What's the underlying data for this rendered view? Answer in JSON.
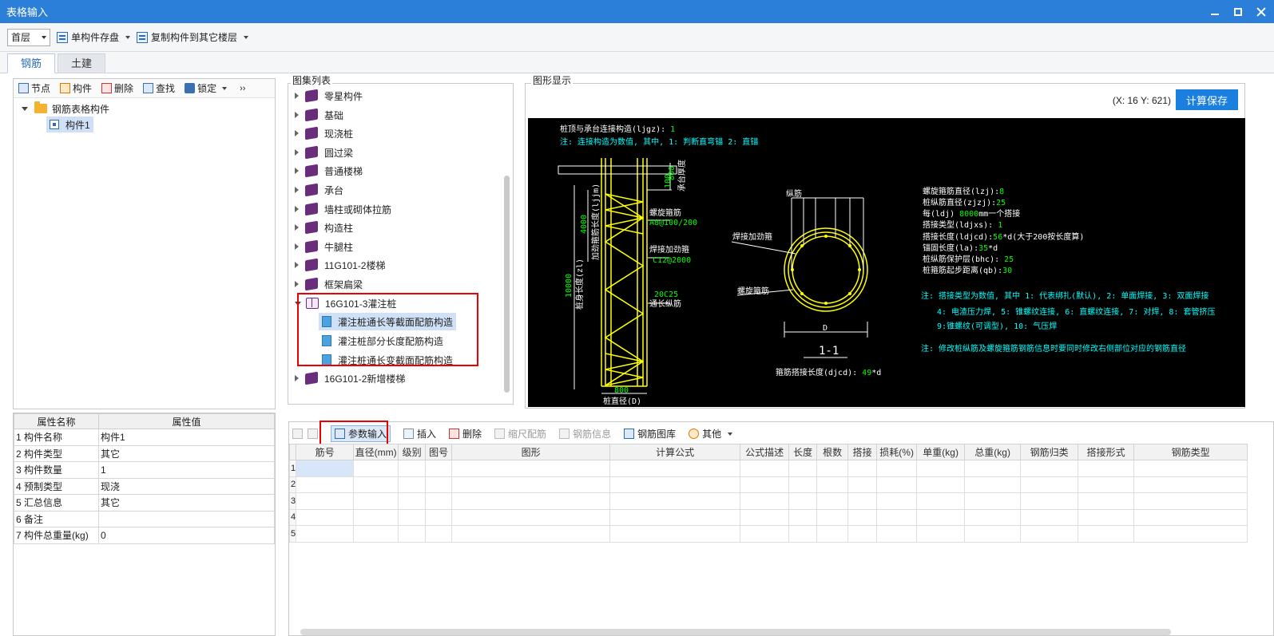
{
  "window": {
    "title": "表格输入"
  },
  "toolbar": {
    "floor_value": "首层",
    "save_component_label": "单构件存盘",
    "copy_to_floors_label": "复制构件到其它楼层"
  },
  "tabs": [
    {
      "label": "钢筋"
    },
    {
      "label": "土建"
    }
  ],
  "left_toolbar": {
    "node_label": "节点",
    "component_label": "构件",
    "delete_label": "删除",
    "find_label": "查找",
    "lock_label": "锁定"
  },
  "tree": {
    "root_label": "钢筋表格构件",
    "child_label": "构件1"
  },
  "properties": {
    "header_name": "属性名称",
    "header_value": "属性值",
    "rows": [
      {
        "num": "1",
        "name": "构件名称",
        "value": "构件1"
      },
      {
        "num": "2",
        "name": "构件类型",
        "value": "其它"
      },
      {
        "num": "3",
        "name": "构件数量",
        "value": "1"
      },
      {
        "num": "4",
        "name": "预制类型",
        "value": "现浇"
      },
      {
        "num": "5",
        "name": "汇总信息",
        "value": "其它"
      },
      {
        "num": "6",
        "name": "备注",
        "value": ""
      },
      {
        "num": "7",
        "name": "构件总重量(kg)",
        "value": "0"
      }
    ]
  },
  "figure_list": {
    "title": "图集列表",
    "items": [
      "零星构件",
      "基础",
      "现浇桩",
      "圆过梁",
      "普通楼梯",
      "承台",
      "墙柱或砌体拉筋",
      "构造柱",
      "牛腿柱",
      "11G101-2楼梯",
      "框架扁梁"
    ],
    "expanded_label": "16G101-3灌注桩",
    "children": [
      "灌注桩通长等截面配筋构造",
      "灌注桩部分长度配筋构造",
      "灌注桩通长变截面配筋构造"
    ],
    "last_item": "16G101-2新增楼梯"
  },
  "graphic": {
    "title": "图形显示",
    "coord": "(X: 16 Y: 621)",
    "calc_save_label": "计算保存",
    "cad": {
      "top1_label": "桩顶与承台连接构造(ljgz): ",
      "top1_value": "1",
      "top2": "注: 连接构造为数值, 其中, 1: 判断直弯锚      2: 直锚",
      "dim_100": "100",
      "dim_800_top": "800",
      "cap_label": "承台厚度",
      "dim_4000": "4000",
      "stiff_length_label": "加劲箍筋长度(ljjm)",
      "dim_10000": "10000",
      "pile_length_label": "桩身长度(zl)",
      "spiral_label": "螺旋箍筋",
      "spiral_spec": "A8@100/200",
      "weld_stiff_label": "焊接加劲箍",
      "weld_stiff_spec": "C12@2000",
      "long_bar_spec": "20C25",
      "long_bar_label": "通长纵筋",
      "dim_800_bottom": "800",
      "diameter_label": "桩直径(D)",
      "section_long_bar": "纵筋",
      "section_weld": "焊接加劲箍",
      "section_spiral": "螺旋箍筋",
      "section_d": "D",
      "section_title": "1-1",
      "overlap_label": "箍筋搭接长度(djcd): ",
      "overlap_value": "49",
      "overlap_unit": "*d",
      "params": [
        {
          "label": "螺旋箍筋直径(lzj):",
          "value": "8",
          "unit": ""
        },
        {
          "label": "桩纵筋直径(zjzj):",
          "value": "25",
          "unit": ""
        },
        {
          "label": "每(ldj) ",
          "value": "8000",
          "unit": "mm一个搭接"
        },
        {
          "label": "搭接类型(ldjxs): ",
          "value": "1",
          "unit": ""
        },
        {
          "label": "搭接长度(ldjcd):",
          "value": "56",
          "unit": "*d(大于200按长度算)"
        },
        {
          "label": "锚固长度(la):",
          "value": "35",
          "unit": "*d"
        },
        {
          "label": "桩纵筋保护层(bhc): ",
          "value": "25",
          "unit": ""
        },
        {
          "label": "桩箍筋起步距离(qb):",
          "value": "30",
          "unit": ""
        }
      ],
      "notes": [
        "注: 搭接类型为数值, 其中 1: 代表绑扎(默认), 2: 单面焊接, 3: 双面焊接",
        "4: 电渣压力焊, 5: 锥螺纹连接, 6: 直螺纹连接, 7: 对焊, 8: 套管挤压",
        "9:锥螺纹(可调型), 10: 气压焊",
        "注: 修改桩纵筋及螺旋箍筋钢筋信息时要同时修改右侧部位对应的钢筋直径"
      ]
    }
  },
  "rebar_toolbar": {
    "param_input_label": "参数输入",
    "insert_label": "插入",
    "delete_label": "删除",
    "scale_label": "缩尺配筋",
    "info_label": "钢筋信息",
    "library_label": "钢筋图库",
    "other_label": "其他"
  },
  "rebar_table": {
    "headers": [
      "筋号",
      "直径(mm)",
      "级别",
      "图号",
      "图形",
      "计算公式",
      "公式描述",
      "长度",
      "根数",
      "搭接",
      "损耗(%)",
      "单重(kg)",
      "总重(kg)",
      "钢筋归类",
      "搭接形式",
      "钢筋类型"
    ],
    "row_numbers": [
      "1",
      "2",
      "3",
      "4",
      "5"
    ]
  },
  "colors": {
    "title_bar": "#2b7fd8",
    "accent_button": "#1a7fdf",
    "highlight_box": "#ee0000",
    "cad_yellow": "#ffff00",
    "cad_green": "#00ff00",
    "cad_cyan": "#00ffff"
  }
}
